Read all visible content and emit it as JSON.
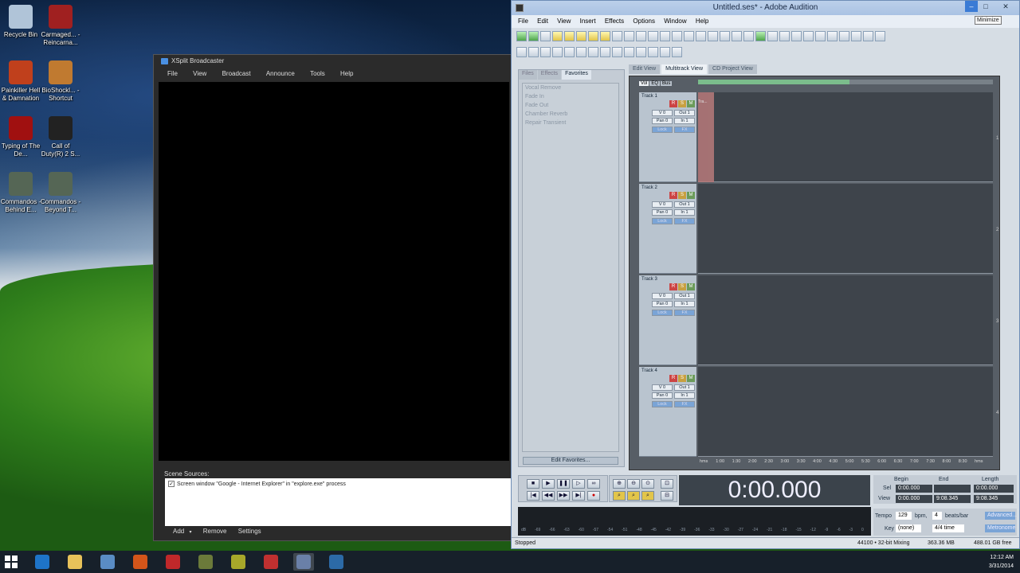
{
  "desktop": {
    "icons": [
      {
        "label": "Recycle Bin",
        "color": "#b0c4d8"
      },
      {
        "label": "Carmaged... - Reincarna...",
        "color": "#a02020"
      },
      {
        "label": "Painkiller Hell & Damnation",
        "color": "#c0401c"
      },
      {
        "label": "BioShockl... - Shortcut",
        "color": "#c07a30"
      },
      {
        "label": "Typing of The De...",
        "color": "#a01010"
      },
      {
        "label": "Call of Duty(R) 2 S...",
        "color": "#222222"
      },
      {
        "label": "Commandos - Behind E...",
        "color": "#556655"
      },
      {
        "label": "Commandos - Beyond T...",
        "color": "#556655"
      }
    ]
  },
  "xsplit": {
    "title": "XSplit Broadcaster",
    "menu": [
      "File",
      "View",
      "Broadcast",
      "Announce",
      "Tools",
      "Help"
    ],
    "scene_sources_label": "Scene Sources:",
    "source_item": "Screen window \"Google - Internet Explorer\" in \"explore.exe\" process",
    "actions": {
      "add": "Add",
      "remove": "Remove",
      "settings": "Settings"
    }
  },
  "audition": {
    "title": "Untitled.ses* - Adobe Audition",
    "menu": [
      "File",
      "Edit",
      "View",
      "Insert",
      "Effects",
      "Options",
      "Window",
      "Help"
    ],
    "tooltip": "Minimize",
    "panel_tabs": [
      "Files",
      "Effects",
      "Favorites"
    ],
    "favorites": [
      "Vocal Remove",
      "Fade In",
      "Fade Out",
      "Chamber Reverb",
      "Repair Transient"
    ],
    "edit_favorites": "Edit Favorites...",
    "view_tabs": [
      "Edit View",
      "Multitrack View",
      "CD Project View"
    ],
    "track_tabs": [
      "Vol",
      "EQ",
      "Bus"
    ],
    "tracks": [
      {
        "name": "Track 1",
        "vol": "V 0",
        "out": "Out 1",
        "pan": "Pan 0",
        "in": "In 1",
        "lock": "Lock",
        "fx": "FX",
        "num": "1",
        "clip": "Tra..."
      },
      {
        "name": "Track 2",
        "vol": "V 0",
        "out": "Out 1",
        "pan": "Pan 0",
        "in": "In 1",
        "lock": "Lock",
        "fx": "FX",
        "num": "2"
      },
      {
        "name": "Track 3",
        "vol": "V 0",
        "out": "Out 1",
        "pan": "Pan 0",
        "in": "In 1",
        "lock": "Lock",
        "fx": "FX",
        "num": "3"
      },
      {
        "name": "Track 4",
        "vol": "V 0",
        "out": "Out 1",
        "pan": "Pan 0",
        "in": "In 1",
        "lock": "Lock",
        "fx": "FX",
        "num": "4"
      }
    ],
    "rsm": [
      "R",
      "S",
      "M"
    ],
    "ruler": [
      "hms",
      "1:00",
      "1:30",
      "2:00",
      "2:30",
      "3:00",
      "3:30",
      "4:00",
      "4:30",
      "5:00",
      "5:30",
      "6:00",
      "6:30",
      "7:00",
      "7:30",
      "8:00",
      "8:30",
      "hms"
    ],
    "time_display": "0:00.000",
    "selview": {
      "begin": "Begin",
      "end": "End",
      "length": "Length",
      "sel": "Sel",
      "view": "View",
      "sel_begin": "0:00.000",
      "sel_end": "",
      "sel_length": "0:00.000",
      "view_begin": "0:00.000",
      "view_end": "9:08.345",
      "view_length": "9:08.345"
    },
    "meter_scale": [
      "dB",
      "-69",
      "-66",
      "-63",
      "-60",
      "-57",
      "-54",
      "-51",
      "-48",
      "-45",
      "-42",
      "-39",
      "-36",
      "-33",
      "-30",
      "-27",
      "-24",
      "-21",
      "-18",
      "-15",
      "-12",
      "-9",
      "-6",
      "-3",
      "0"
    ],
    "tempo": {
      "label": "Tempo",
      "value": "129",
      "bpm": "bpm,",
      "beats": "4",
      "beats_label": "beats/bar",
      "key_label": "Key",
      "key_value": "(none)",
      "time_sig": "4/4 time",
      "advanced": "Advanced...",
      "metronome": "Metronome"
    },
    "status": {
      "state": "Stopped",
      "format": "44100 • 32-bit Mixing",
      "mem": "363.36 MB",
      "free": "488.01 GB free"
    }
  },
  "taskbar": {
    "clock_time": "12:12 AM",
    "clock_date": "3/31/2014",
    "apps": [
      "#1e74c8",
      "#e8c25a",
      "#5a8cc4",
      "#d3551a",
      "#c0282a",
      "#6b7a3a",
      "#a8a82a",
      "#c03030",
      "#6a80a8",
      "#2c6aa6"
    ]
  }
}
